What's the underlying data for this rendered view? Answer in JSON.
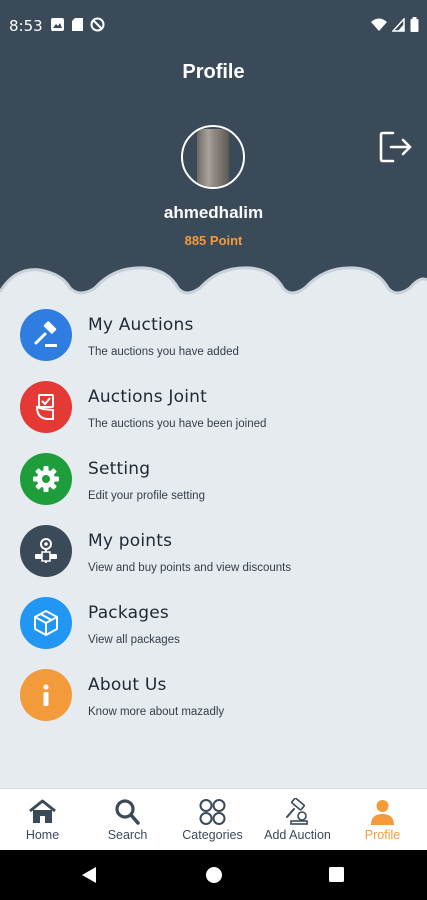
{
  "status_bar": {
    "time": "8:53"
  },
  "header": {
    "title": "Profile",
    "username": "ahmedhalim",
    "points": "885 Point"
  },
  "menu": {
    "items": [
      {
        "title": "My Auctions",
        "subtitle": "The auctions you have added",
        "icon": "gavel-icon",
        "color": "#2f7de1"
      },
      {
        "title": "Auctions Joint",
        "subtitle": "The auctions you have been joined",
        "icon": "hand-card-icon",
        "color": "#e53935"
      },
      {
        "title": "Setting",
        "subtitle": "Edit your profile setting",
        "icon": "gear-icon",
        "color": "#1e9e3a"
      },
      {
        "title": "My points",
        "subtitle": "View and buy points and view discounts",
        "icon": "coin-points-icon",
        "color": "#3b4a58"
      },
      {
        "title": "Packages",
        "subtitle": "View all packages",
        "icon": "package-box-icon",
        "color": "#2196f3"
      },
      {
        "title": "About Us",
        "subtitle": "Know more about mazadly",
        "icon": "info-icon",
        "color": "#f39a3b"
      }
    ]
  },
  "bottom_nav": {
    "items": [
      {
        "label": "Home",
        "icon": "home-icon"
      },
      {
        "label": "Search",
        "icon": "search-icon"
      },
      {
        "label": "Categories",
        "icon": "categories-icon"
      },
      {
        "label": "Add Auction",
        "icon": "add-auction-icon"
      },
      {
        "label": "Profile",
        "icon": "profile-icon",
        "active": true
      }
    ]
  },
  "colors": {
    "header_bg": "#3b4a58",
    "accent": "#f39a3b",
    "page_bg": "#e6ebf0"
  }
}
